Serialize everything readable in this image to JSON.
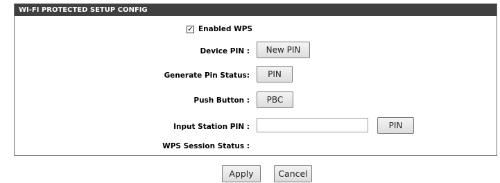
{
  "panel": {
    "title": "WI-FI PROTECTED SETUP CONFIG"
  },
  "wps": {
    "enabled_checked": true,
    "enabled_label": "Enabled WPS"
  },
  "device_pin": {
    "label": "Device PIN :",
    "button_label": "New PIN"
  },
  "generate_pin_status": {
    "label": "Generate Pin Status:",
    "button_label": "PIN"
  },
  "push_button": {
    "label": "Push Button :",
    "button_label": "PBC"
  },
  "input_station_pin": {
    "label": "Input Station PIN :",
    "value": "",
    "button_label": "PIN"
  },
  "wps_session_status": {
    "label": "WPS Session Status :",
    "value": ""
  },
  "footer": {
    "apply_label": "Apply",
    "cancel_label": "Cancel"
  },
  "icons": {
    "checkbox": "checkbox-checked-icon"
  }
}
